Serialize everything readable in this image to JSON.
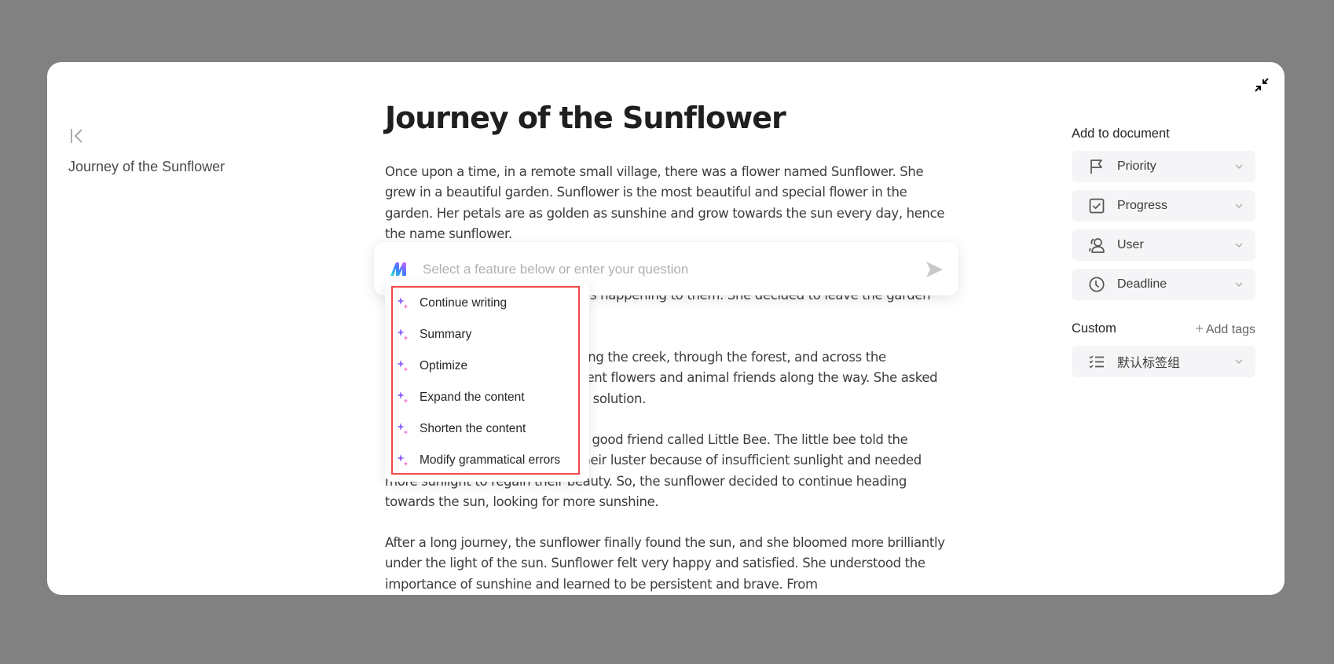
{
  "sidebar": {
    "document_title": "Journey of the Sunflower"
  },
  "document": {
    "title": "Journey of the Sunflower",
    "paragraphs": [
      "Once upon a time, in a remote small village, there was a flower named Sunflower. She grew in a beautiful garden. Sunflower is the most beautiful and special flower in the garden. Her petals are as golden as sunshine and grow towards the sun every day, hence the name sunflower.",
      "One day, the flowers in the garden began to wither. Sunflower felt very anxious and uneasy and didn't know what was happening to them. She decided to leave the garden and find a solution.",
      "Sunflower began her journey along the creek, through the forest, and across the mountains. She met many different flowers and animal friends along the way. She asked them for advice, hoping to find a solution.",
      "On her journey, Sunflower met a good friend called Little Bee. The little bee told the sunflower that the flowers lost their luster because of insufficient sunlight and needed more sunlight to regain their beauty. So, the sunflower decided to continue heading towards the sun, looking for more sunshine.",
      "After a long journey, the sunflower finally found the sun, and she bloomed more brilliantly under the light of the sun. Sunflower felt very happy and satisfied. She understood the importance of sunshine and learned to be persistent and brave. From"
    ]
  },
  "ai_assistant": {
    "input_value": "",
    "input_placeholder": "Select a feature below or enter your question",
    "menu_items": [
      {
        "label": "Continue writing"
      },
      {
        "label": "Summary"
      },
      {
        "label": "Optimize"
      },
      {
        "label": "Expand the content"
      },
      {
        "label": "Shorten the content"
      },
      {
        "label": "Modify grammatical errors"
      }
    ],
    "highlight_color": "#f04848"
  },
  "properties_panel": {
    "heading": "Add to document",
    "fields": [
      {
        "label": "Priority",
        "icon": "flag-icon"
      },
      {
        "label": "Progress",
        "icon": "checkbox-icon"
      },
      {
        "label": "User",
        "icon": "users-icon"
      },
      {
        "label": "Deadline",
        "icon": "clock-icon"
      }
    ],
    "custom_heading": "Custom",
    "add_tags_label": "Add tags",
    "tag_group": {
      "label": "默认标签组",
      "icon": "checklist-icon"
    }
  }
}
